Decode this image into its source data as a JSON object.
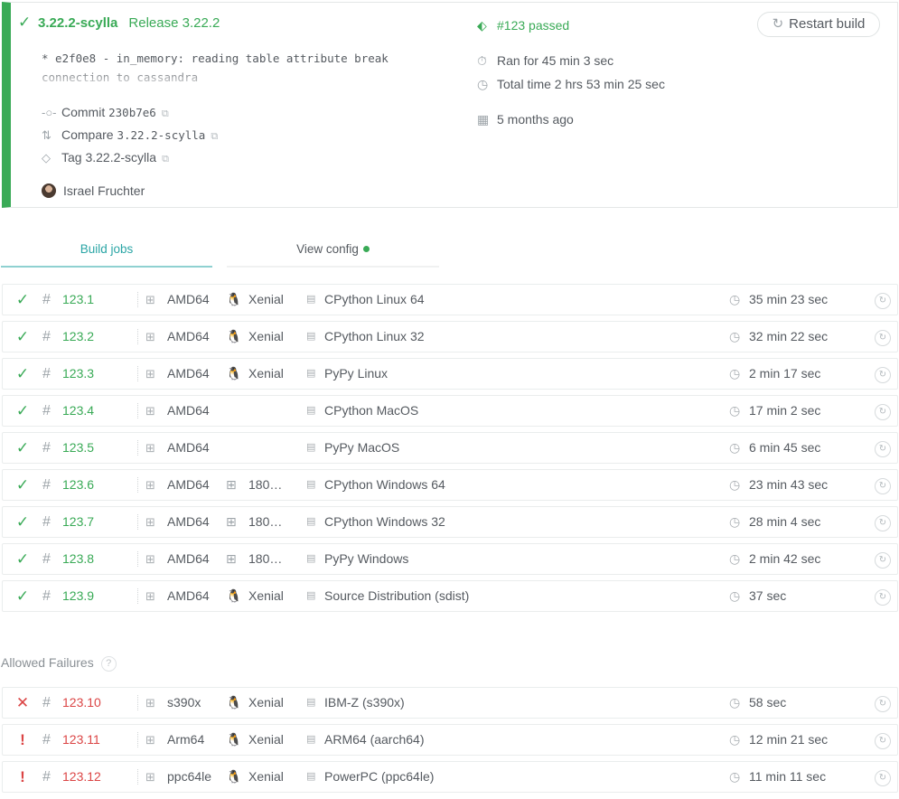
{
  "build": {
    "branch": "3.22.2-scylla",
    "release": "Release 3.22.2",
    "commit_message": "* e2f0e8 - in_memory: reading table attribute break connection to cassandra",
    "commit_label": "Commit",
    "commit_sha": "230b7e6",
    "compare_label": "Compare",
    "compare_ref": "3.22.2-scylla",
    "tag_label": "Tag 3.22.2-scylla",
    "author": "Israel Fruchter",
    "status": "#123 passed",
    "ran_for": "Ran for 45 min 3 sec",
    "total_time": "Total time 2 hrs 53 min 25 sec",
    "finished": "5 months ago",
    "restart_label": "Restart build",
    "colors": {
      "passed": "#39aa56",
      "failed": "#db4545",
      "tab": "#2aa5a5"
    }
  },
  "tabs": {
    "build_jobs": "Build jobs",
    "view_config": "View config"
  },
  "jobs": [
    {
      "state": "passed",
      "number": "123.1",
      "arch": "AMD64",
      "os_icon": "linux-icon",
      "os": "Xenial",
      "name": "CPython Linux 64",
      "duration": "35 min 23 sec"
    },
    {
      "state": "passed",
      "number": "123.2",
      "arch": "AMD64",
      "os_icon": "linux-icon",
      "os": "Xenial",
      "name": "CPython Linux 32",
      "duration": "32 min 22 sec"
    },
    {
      "state": "passed",
      "number": "123.3",
      "arch": "AMD64",
      "os_icon": "linux-icon",
      "os": "Xenial",
      "name": "PyPy Linux",
      "duration": "2 min 17 sec"
    },
    {
      "state": "passed",
      "number": "123.4",
      "arch": "AMD64",
      "os_icon": "apple-icon",
      "os": "",
      "name": "CPython MacOS",
      "duration": "17 min 2 sec"
    },
    {
      "state": "passed",
      "number": "123.5",
      "arch": "AMD64",
      "os_icon": "apple-icon",
      "os": "",
      "name": "PyPy MacOS",
      "duration": "6 min 45 sec"
    },
    {
      "state": "passed",
      "number": "123.6",
      "arch": "AMD64",
      "os_icon": "windows-icon",
      "os": "180…",
      "name": "CPython Windows 64",
      "duration": "23 min 43 sec"
    },
    {
      "state": "passed",
      "number": "123.7",
      "arch": "AMD64",
      "os_icon": "windows-icon",
      "os": "180…",
      "name": "CPython Windows 32",
      "duration": "28 min 4 sec"
    },
    {
      "state": "passed",
      "number": "123.8",
      "arch": "AMD64",
      "os_icon": "windows-icon",
      "os": "180…",
      "name": "PyPy Windows",
      "duration": "2 min 42 sec"
    },
    {
      "state": "passed",
      "number": "123.9",
      "arch": "AMD64",
      "os_icon": "linux-icon",
      "os": "Xenial",
      "name": "Source Distribution (sdist)",
      "duration": "37 sec"
    }
  ],
  "allowed_failures": {
    "heading": "Allowed Failures",
    "help": "?",
    "jobs": [
      {
        "state": "failed",
        "number": "123.10",
        "arch": "s390x",
        "os_icon": "linux-icon",
        "os": "Xenial",
        "name": "IBM-Z (s390x)",
        "duration": "58 sec"
      },
      {
        "state": "errored",
        "number": "123.11",
        "arch": "Arm64",
        "os_icon": "linux-icon",
        "os": "Xenial",
        "name": "ARM64 (aarch64)",
        "duration": "12 min 21 sec"
      },
      {
        "state": "errored",
        "number": "123.12",
        "arch": "ppc64le",
        "os_icon": "linux-icon",
        "os": "Xenial",
        "name": "PowerPC (ppc64le)",
        "duration": "11 min 11 sec"
      }
    ]
  }
}
